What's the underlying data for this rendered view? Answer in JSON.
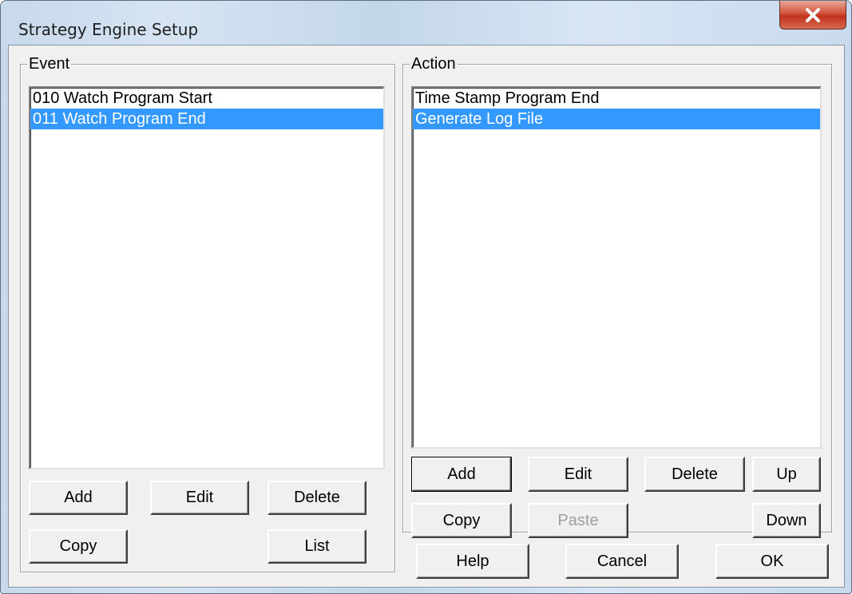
{
  "window": {
    "title": "Strategy Engine Setup",
    "close_icon": "close-x-icon"
  },
  "event": {
    "legend": "Event",
    "items": [
      {
        "label": "010 Watch Program Start",
        "selected": false
      },
      {
        "label": "011 Watch Program End",
        "selected": true
      }
    ],
    "buttons": {
      "add": "Add",
      "edit": "Edit",
      "delete": "Delete",
      "copy": "Copy",
      "list": "List"
    }
  },
  "action": {
    "legend": "Action",
    "items": [
      {
        "label": "Time Stamp Program End",
        "selected": false
      },
      {
        "label": "Generate Log File",
        "selected": true
      }
    ],
    "buttons": {
      "add": "Add",
      "edit": "Edit",
      "delete": "Delete",
      "up": "Up",
      "copy": "Copy",
      "paste": "Paste",
      "down": "Down"
    }
  },
  "footer": {
    "help": "Help",
    "cancel": "Cancel",
    "ok": "OK"
  },
  "colors": {
    "selection": "#3399ff",
    "face": "#f0f0f0",
    "close_red": "#c1321c"
  }
}
